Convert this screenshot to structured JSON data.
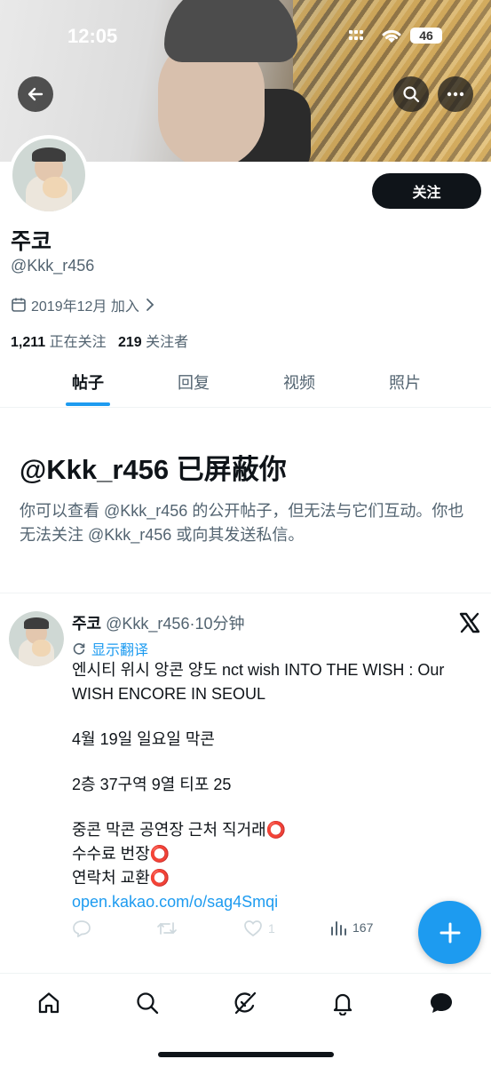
{
  "status_bar": {
    "time": "12:05",
    "battery": "46"
  },
  "profile": {
    "display_name": "주코",
    "handle": "@Kkk_r456",
    "joined": "2019年12月 加入",
    "following_count": "1,211",
    "following_label": "正在关注",
    "followers_count": "219",
    "followers_label": "关注者",
    "follow_button": "关注"
  },
  "tabs": [
    "帖子",
    "回复",
    "视频",
    "照片"
  ],
  "blocked": {
    "title": "@Kkk_r456 已屏蔽你",
    "description": "你可以查看 @Kkk_r456 的公开帖子，但无法与它们互动。你也无法关注 @Kkk_r456 或向其发送私信。"
  },
  "tweet": {
    "author_name": "주코",
    "author_meta": "@Kkk_r456·10分钟",
    "translate_label": "显示翻译",
    "lines": [
      "엔시티 위시 앙콘 양도 nct wish INTO THE WISH : Our WISH ENCORE IN SEOUL",
      "4월 19일 일요일 막콘",
      "2층 37구역 9열 티포 25",
      "중콘 막콘 공연장 근처 직거래⭕",
      "수수료 번장⭕",
      "연락처 교환⭕"
    ],
    "link": "open.kakao.com/o/sag4Smqi",
    "like_count": "1",
    "view_count": "167"
  },
  "colors": {
    "accent": "#1d9bf0",
    "text": "#0f1419",
    "muted": "#536471"
  },
  "icons": [
    "back-arrow-icon",
    "search-icon",
    "more-icon",
    "calendar-icon",
    "chevron-right-icon",
    "x-logo-icon",
    "translate-icon",
    "reply-icon",
    "retweet-icon",
    "like-icon",
    "views-icon",
    "compose-icon",
    "home-icon",
    "explore-icon",
    "grok-icon",
    "notifications-icon",
    "messages-icon"
  ]
}
